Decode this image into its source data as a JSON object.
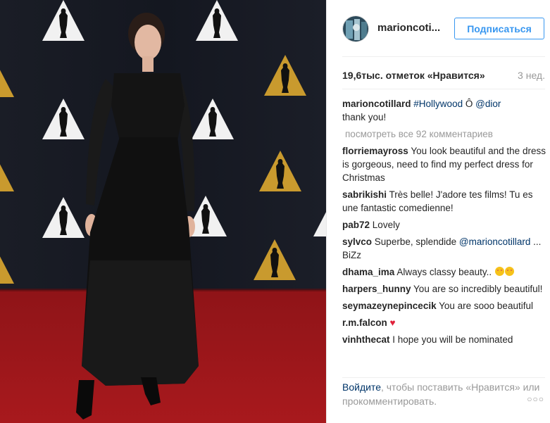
{
  "post": {
    "username": "marioncoti...",
    "follow_label": "Подписаться",
    "likes": "19,6тыс. отметок «Нравится»",
    "time": "3 нед.",
    "caption": {
      "user": "marioncotillard",
      "hashtag": "#Hollywood",
      "text_mid": " Ô ",
      "mention": "@dior",
      "text_end": "thank you!"
    },
    "view_all": "посмотреть все 92 комментариев",
    "comments": [
      {
        "user": "florriemayross",
        "text": "You look beautiful and the dress is gorgeous, need to find my perfect dress for Christmas"
      },
      {
        "user": "sabrikishi",
        "text": "Très belle! J'adore tes films! Tu es une fantastic comedienne!"
      },
      {
        "user": "pab72",
        "text": "Lovely"
      },
      {
        "user": "sylvco",
        "text_pre": "Superbe, splendide ",
        "mention": "@marioncotillard",
        "text_post": " ... BiZz"
      },
      {
        "user": "dhama_ima",
        "text": "Always classy beauty.."
      },
      {
        "user": "harpers_hunny",
        "text": "You are so incredibly beautiful!"
      },
      {
        "user": "seymazeynepincecik",
        "text": "You are sooo beautiful"
      },
      {
        "user": "r.m.falcon",
        "text": "♥"
      },
      {
        "user": "vinhthecat",
        "text": "I hope you will be nominated"
      }
    ],
    "footer": {
      "login": "Войдите",
      "text": ", чтобы поставить «Нравится» или прокомментировать.",
      "more": "○○○"
    }
  },
  "colors": {
    "accent": "#3897f0",
    "link": "#003569",
    "heart": "#e0213b",
    "carpet": "#a3161b",
    "backdrop": "#15181f",
    "gold": "#c99a2e"
  },
  "icons": [
    "oscar-statuette-icon",
    "heart-icon",
    "emoji-icon",
    "more-options-icon"
  ]
}
